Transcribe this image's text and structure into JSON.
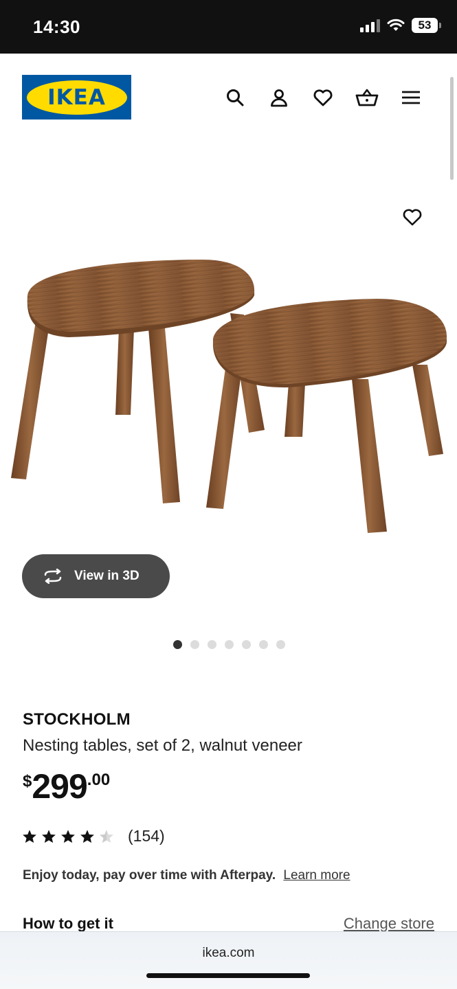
{
  "status_bar": {
    "time": "14:30",
    "battery": "53"
  },
  "header": {
    "logo_text": "IKEA",
    "icons": [
      "search-icon",
      "account-icon",
      "wishlist-heart-icon",
      "shopping-basket-icon",
      "hamburger-menu-icon"
    ]
  },
  "gallery": {
    "view_3d_label": "View in 3D",
    "image_count": 7,
    "active_index": 0
  },
  "product": {
    "name": "STOCKHOLM",
    "description": "Nesting tables, set of 2, walnut veneer",
    "price_currency": "$",
    "price_main": "299",
    "price_decimal": ".00",
    "rating": 4.5,
    "rating_max": 5,
    "review_count": "(154)"
  },
  "afterpay": {
    "text": "Enjoy today, pay over time with Afterpay.",
    "link": "Learn more"
  },
  "delivery": {
    "title": "How to get it",
    "change_store": "Change store"
  },
  "browser": {
    "url": "ikea.com"
  },
  "colors": {
    "ikea_blue": "#0058a3",
    "ikea_yellow": "#ffdb00",
    "walnut": "#8a5a34"
  }
}
